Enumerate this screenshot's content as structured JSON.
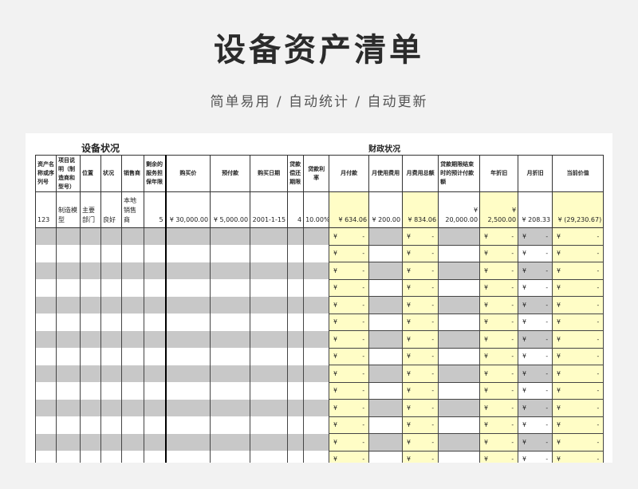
{
  "title": "设备资产清单",
  "subtitle": "简单易用  /  自动统计  /  自动更新",
  "sheet": {
    "section_equipment": "设备状况",
    "section_finance": "财政状况",
    "headers": [
      "资产名称或序列号",
      "项目说明（制造商和型号）",
      "位置",
      "状况",
      "销售商",
      "剩余的服务担保年限",
      "购买价",
      "预付款",
      "购买日期",
      "贷款偿还期限",
      "贷款利率",
      "月付款",
      "月使用费用",
      "月费用总额",
      "贷款期限结束时的预计付款额",
      "年折旧",
      "月折旧",
      "当前价值"
    ],
    "sample": {
      "asset": "123",
      "description": "制造模型",
      "location": "主要部门",
      "condition": "良好",
      "vendor": "本地销售商",
      "warranty": "5",
      "purchase_price": "¥   30,000.00",
      "down_payment": "¥   5,000.00",
      "purchase_date": "2001-1-15",
      "loan_term": "4",
      "interest_rate": "10.00%",
      "monthly_payment": "¥   634.06",
      "monthly_usage": "¥  200.00",
      "monthly_total": "¥   834.06",
      "balloon_payment": "¥  20,000.00",
      "annual_depreciation": "¥  2,500.00",
      "monthly_depreciation": "¥   208.33",
      "current_value": "¥  (29,230.67)"
    },
    "empty_currency_symbol": "¥",
    "empty_currency_dash": "-"
  }
}
